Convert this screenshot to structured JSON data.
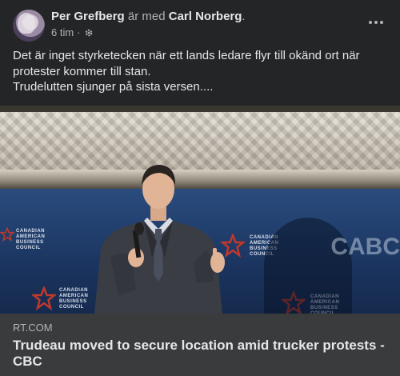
{
  "post": {
    "author": "Per Grefberg",
    "with_text": "är med",
    "tagged": "Carl Norberg",
    "period": ".",
    "time": "6 tim",
    "separator": "·",
    "audience_icon": "gear-icon",
    "body_lines": [
      "Det är inget styrketecken när ett lands ledare flyr till okänd ort när",
      "protester kommer till stan.",
      "Trudelutten sjunger på sista versen...."
    ]
  },
  "image": {
    "logo_lines": [
      "CANADIAN",
      "AMERICAN",
      "BUSINESS",
      "COUNCIL"
    ],
    "backdrop_text": "CABC"
  },
  "link": {
    "domain": "RT.COM",
    "headline": "Trudeau moved to secure location amid trucker protests - CBC"
  },
  "colors": {
    "card_bg": "#242526",
    "footer_bg": "#3a3b3c",
    "text": "#e4e6eb",
    "muted": "#b0b3b8",
    "backdrop": "#203a62",
    "star": "#c0392b"
  }
}
